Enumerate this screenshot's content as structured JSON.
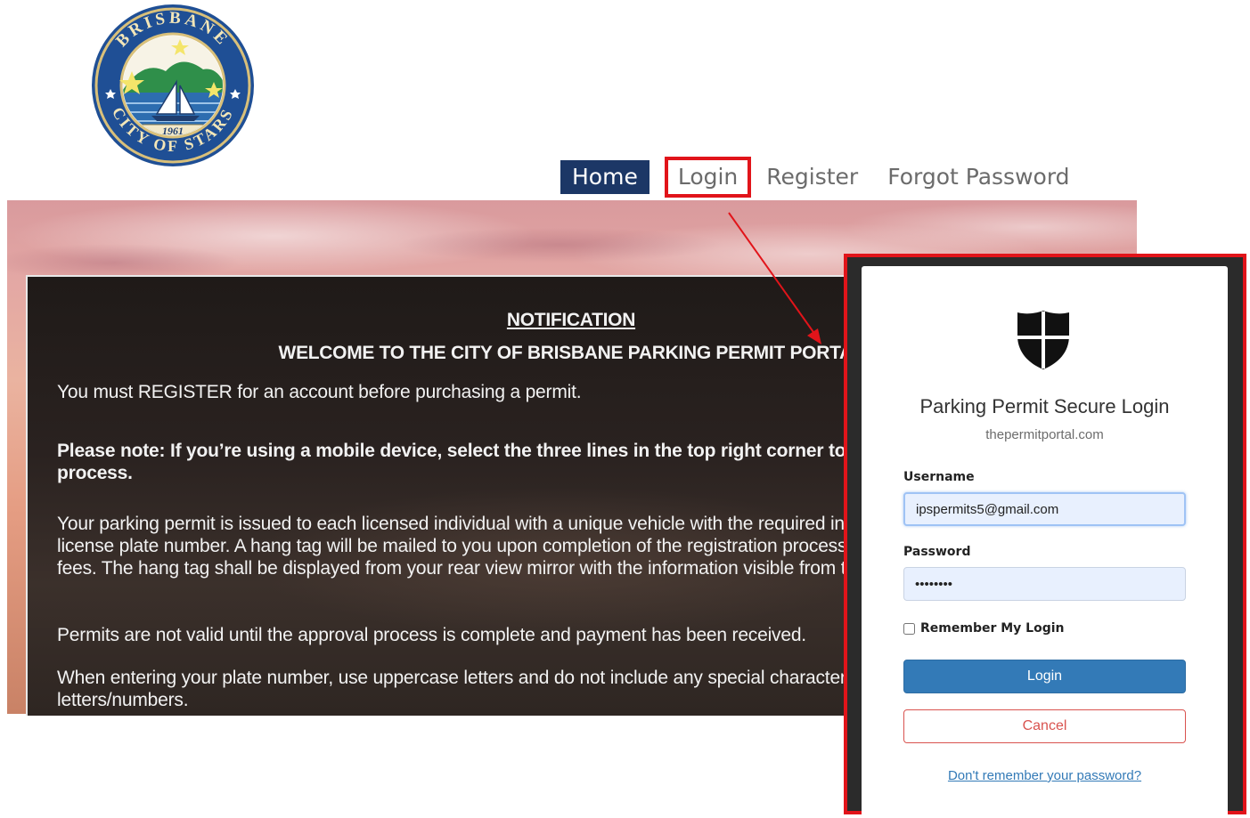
{
  "seal": {
    "top_text": "BRISBANE",
    "bottom_text": "CITY OF STARS",
    "year": "1961"
  },
  "nav": {
    "home": "Home",
    "login": "Login",
    "register": "Register",
    "forgot": "Forgot Password"
  },
  "notice": {
    "heading": "NOTIFICATION",
    "welcome": "WELCOME TO THE CITY OF BRISBANE PARKING PERMIT PORTAL",
    "p1": "You must REGISTER for an account before purchasing a permit.",
    "p2": "Please note: If you’re using a mobile device, select the three lines in the top right corner to begin the registration process.",
    "p3": "Your parking permit is issued to each licensed individual with a unique vehicle with the required information provided, including license plate number. A hang tag will be mailed to you upon completion of the registration process and successful payment of fees. The hang tag shall be displayed from your rear view mirror with the information visible from the front of the vehicle.",
    "p4": "Permits are not valid until the approval process is complete and payment has been received.",
    "p5": "When entering your plate number, use uppercase letters and do not include any special characters or spaces between the letters/numbers."
  },
  "login_modal": {
    "icon": "shield-icon",
    "title": "Parking Permit Secure Login",
    "subtitle": "thepermitportal.com",
    "username_label": "Username",
    "username_value": "ipspermits5@gmail.com",
    "password_label": "Password",
    "password_value": "••••••••",
    "remember_label": "Remember My Login",
    "remember_checked": false,
    "login_button": "Login",
    "cancel_button": "Cancel",
    "forgot_link": "Don't remember your password?"
  },
  "colors": {
    "nav_home_bg": "#1c3766",
    "annotation_red": "#e1141a",
    "login_button": "#337ab7",
    "cancel_red": "#d9534f"
  }
}
